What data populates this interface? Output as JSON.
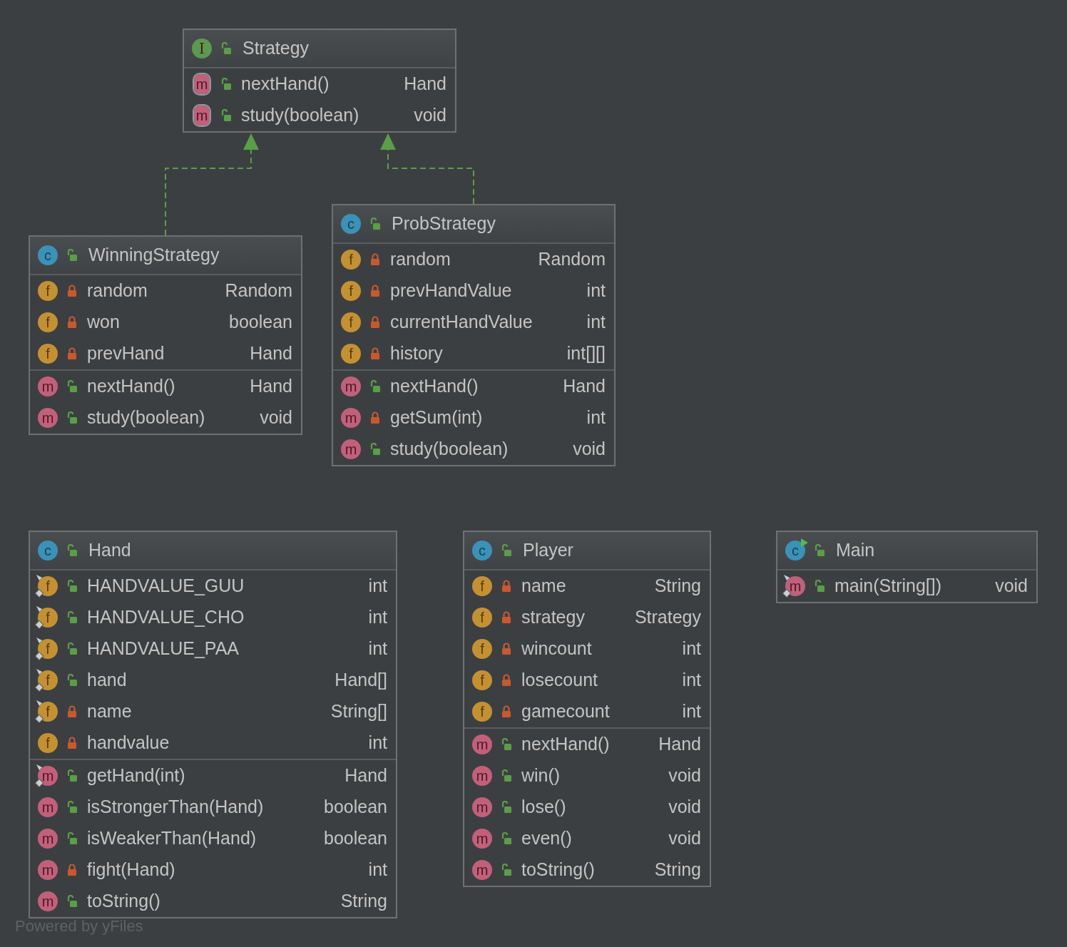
{
  "classes": [
    {
      "kind": "interface",
      "badge": "I",
      "private": false,
      "name": "Strategy",
      "runnable": false,
      "methods": [
        {
          "kind": "abstract_method",
          "badge": "m",
          "static": false,
          "private": false,
          "name": "nextHand()",
          "type": "Hand"
        },
        {
          "kind": "abstract_method",
          "badge": "m",
          "static": false,
          "private": false,
          "name": "study(boolean)",
          "type": "void"
        }
      ]
    },
    {
      "kind": "class",
      "badge": "c",
      "private": false,
      "name": "WinningStrategy",
      "runnable": false,
      "implements_interface": true,
      "fields": [
        {
          "kind": "field",
          "badge": "f",
          "static": false,
          "private": true,
          "name": "random",
          "type": "Random"
        },
        {
          "kind": "field",
          "badge": "f",
          "static": false,
          "private": true,
          "name": "won",
          "type": "boolean"
        },
        {
          "kind": "field",
          "badge": "f",
          "static": false,
          "private": true,
          "name": "prevHand",
          "type": "Hand"
        }
      ],
      "methods": [
        {
          "kind": "method",
          "badge": "m",
          "static": false,
          "private": false,
          "name": "nextHand()",
          "type": "Hand"
        },
        {
          "kind": "method",
          "badge": "m",
          "static": false,
          "private": false,
          "name": "study(boolean)",
          "type": "void"
        }
      ]
    },
    {
      "kind": "class",
      "badge": "c",
      "private": false,
      "name": "ProbStrategy",
      "runnable": false,
      "implements_interface": true,
      "fields": [
        {
          "kind": "field",
          "badge": "f",
          "static": false,
          "private": true,
          "name": "random",
          "type": "Random"
        },
        {
          "kind": "field",
          "badge": "f",
          "static": false,
          "private": true,
          "name": "prevHandValue",
          "type": "int"
        },
        {
          "kind": "field",
          "badge": "f",
          "static": false,
          "private": true,
          "name": "currentHandValue",
          "type": "int"
        },
        {
          "kind": "field",
          "badge": "f",
          "static": false,
          "private": true,
          "name": "history",
          "type": "int[][]"
        }
      ],
      "methods": [
        {
          "kind": "method",
          "badge": "m",
          "static": false,
          "private": false,
          "name": "nextHand()",
          "type": "Hand"
        },
        {
          "kind": "method",
          "badge": "m",
          "static": false,
          "private": true,
          "name": "getSum(int)",
          "type": "int"
        },
        {
          "kind": "method",
          "badge": "m",
          "static": false,
          "private": false,
          "name": "study(boolean)",
          "type": "void"
        }
      ]
    },
    {
      "kind": "class",
      "badge": "c",
      "private": false,
      "name": "Hand",
      "runnable": false,
      "fields": [
        {
          "kind": "field",
          "badge": "f",
          "static": true,
          "private": false,
          "name": "HANDVALUE_GUU",
          "type": "int"
        },
        {
          "kind": "field",
          "badge": "f",
          "static": true,
          "private": false,
          "name": "HANDVALUE_CHO",
          "type": "int"
        },
        {
          "kind": "field",
          "badge": "f",
          "static": true,
          "private": false,
          "name": "HANDVALUE_PAA",
          "type": "int"
        },
        {
          "kind": "field",
          "badge": "f",
          "static": true,
          "private": false,
          "name": "hand",
          "type": "Hand[]"
        },
        {
          "kind": "field",
          "badge": "f",
          "static": true,
          "private": true,
          "name": "name",
          "type": "String[]"
        },
        {
          "kind": "field",
          "badge": "f",
          "static": false,
          "private": true,
          "name": "handvalue",
          "type": "int"
        }
      ],
      "methods": [
        {
          "kind": "method",
          "badge": "m",
          "static": true,
          "private": false,
          "name": "getHand(int)",
          "type": "Hand"
        },
        {
          "kind": "method",
          "badge": "m",
          "static": false,
          "private": false,
          "name": "isStrongerThan(Hand)",
          "type": "boolean"
        },
        {
          "kind": "method",
          "badge": "m",
          "static": false,
          "private": false,
          "name": "isWeakerThan(Hand)",
          "type": "boolean"
        },
        {
          "kind": "method",
          "badge": "m",
          "static": false,
          "private": true,
          "name": "fight(Hand)",
          "type": "int"
        },
        {
          "kind": "method",
          "badge": "m",
          "static": false,
          "private": false,
          "name": "toString()",
          "type": "String"
        }
      ]
    },
    {
      "kind": "class",
      "badge": "c",
      "private": false,
      "name": "Player",
      "runnable": false,
      "fields": [
        {
          "kind": "field",
          "badge": "f",
          "static": false,
          "private": true,
          "name": "name",
          "type": "String"
        },
        {
          "kind": "field",
          "badge": "f",
          "static": false,
          "private": true,
          "name": "strategy",
          "type": "Strategy"
        },
        {
          "kind": "field",
          "badge": "f",
          "static": false,
          "private": true,
          "name": "wincount",
          "type": "int"
        },
        {
          "kind": "field",
          "badge": "f",
          "static": false,
          "private": true,
          "name": "losecount",
          "type": "int"
        },
        {
          "kind": "field",
          "badge": "f",
          "static": false,
          "private": true,
          "name": "gamecount",
          "type": "int"
        }
      ],
      "methods": [
        {
          "kind": "method",
          "badge": "m",
          "static": false,
          "private": false,
          "name": "nextHand()",
          "type": "Hand"
        },
        {
          "kind": "method",
          "badge": "m",
          "static": false,
          "private": false,
          "name": "win()",
          "type": "void"
        },
        {
          "kind": "method",
          "badge": "m",
          "static": false,
          "private": false,
          "name": "lose()",
          "type": "void"
        },
        {
          "kind": "method",
          "badge": "m",
          "static": false,
          "private": false,
          "name": "even()",
          "type": "void"
        },
        {
          "kind": "method",
          "badge": "m",
          "static": false,
          "private": false,
          "name": "toString()",
          "type": "String"
        }
      ]
    },
    {
      "kind": "class",
      "badge": "c",
      "private": false,
      "name": "Main",
      "runnable": true,
      "methods": [
        {
          "kind": "method",
          "badge": "m",
          "static": true,
          "private": false,
          "name": "main(String[])",
          "type": "void"
        }
      ]
    }
  ],
  "footer": "Powered by yFiles"
}
